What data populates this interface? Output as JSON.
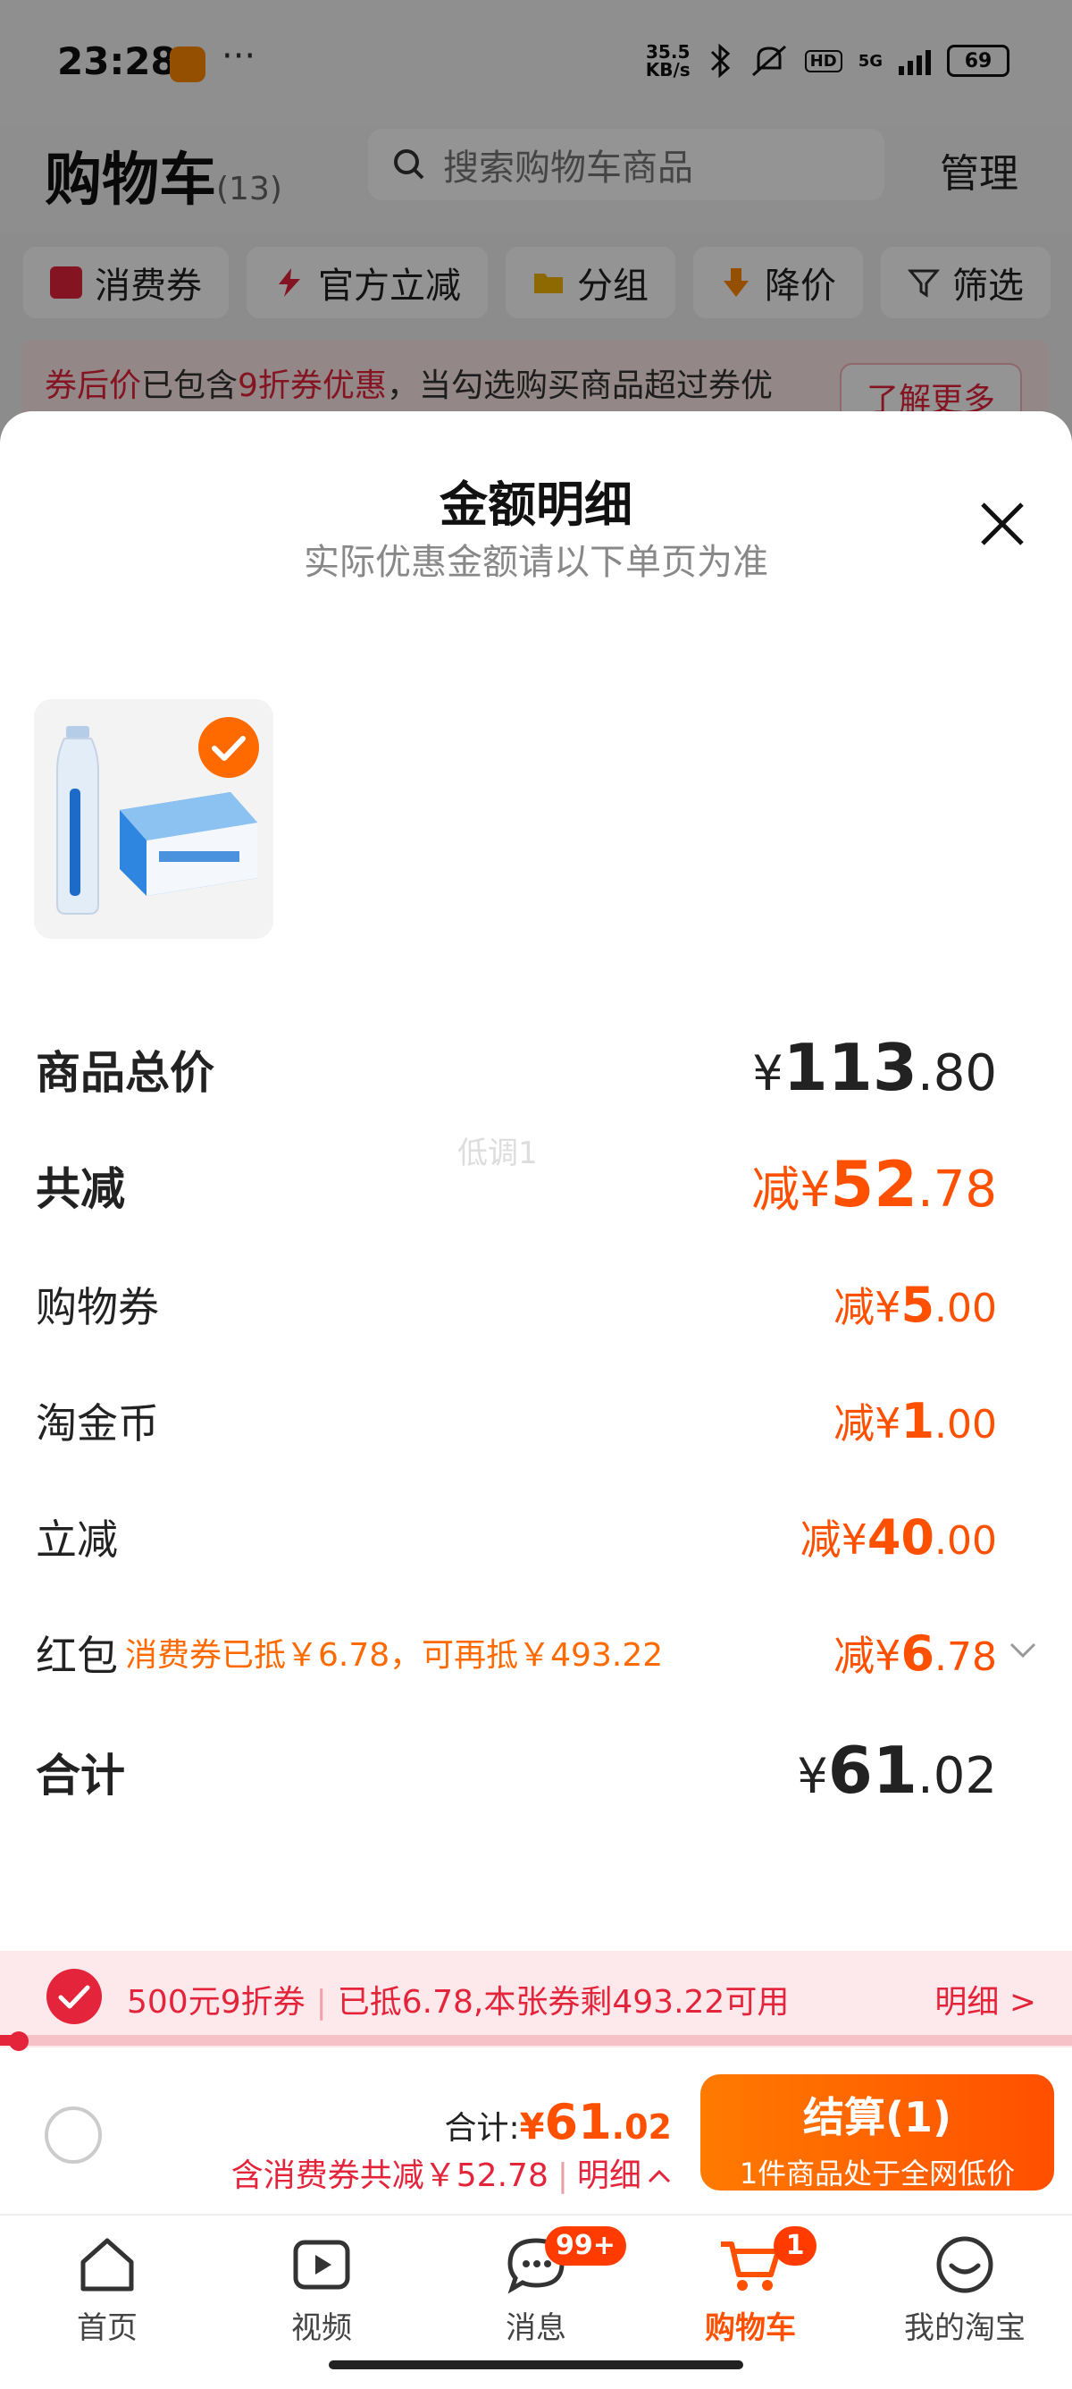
{
  "status_bar": {
    "time": "23:28",
    "speed_top": "35.5",
    "speed_bottom": "KB/s",
    "network": "5G",
    "hd": "HD",
    "battery": "69"
  },
  "header": {
    "title": "购物车",
    "count": "(13)",
    "search_placeholder": "搜索购物车商品",
    "manage": "管理"
  },
  "filters": [
    {
      "label": "消费券",
      "icon": "coupon-icon"
    },
    {
      "label": "官方立减",
      "icon": "lightning-icon"
    },
    {
      "label": "分组",
      "icon": "folder-icon"
    },
    {
      "label": "降价",
      "icon": "down-arrow-icon"
    },
    {
      "label": "筛选",
      "icon": "filter-icon"
    }
  ],
  "promo": {
    "prefix": "券后价",
    "text_a": "已包含",
    "discount": "9折券优惠",
    "text_b": "，当勾选购买商品超过券优",
    "button": "了解更多"
  },
  "sheet": {
    "title": "金额明细",
    "subtitle": "实际优惠金额请以下单页为准",
    "watermark": "低调1",
    "rows": {
      "total_price": {
        "label": "商品总价",
        "yen": "¥",
        "int": "113",
        "dec": ".80"
      },
      "total_discount": {
        "label": "共减",
        "prefix": "减¥",
        "int": "52",
        "dec": ".78"
      },
      "shopping_coupon": {
        "label": "购物券",
        "prefix": "减¥",
        "int": "5",
        "dec": ".00"
      },
      "taojin_coin": {
        "label": "淘金币",
        "prefix": "减¥",
        "int": "1",
        "dec": ".00"
      },
      "instant_discount": {
        "label": "立减",
        "prefix": "减¥",
        "int": "40",
        "dec": ".00"
      },
      "red_packet": {
        "label": "红包",
        "note": "消费券已抵￥6.78，可再抵￥493.22",
        "prefix": "减¥",
        "int": "6",
        "dec": ".78"
      },
      "sum": {
        "label": "合计",
        "yen": "¥",
        "int": "61",
        "dec": ".02"
      }
    }
  },
  "coupon_strip": {
    "name": "500元9折券",
    "used": "已抵6.78,本张券剩493.22可用",
    "detail": "明细 >",
    "progress": 0.014
  },
  "checkout": {
    "total_label": "合计:",
    "yen": "¥",
    "total_int": "61",
    "total_dec": ".02",
    "saving": "含消费券共减￥52.78",
    "detail": "明细",
    "pay_label": "结算(1)",
    "pay_sub": "1件商品处于全网低价"
  },
  "tabs": [
    {
      "label": "首页",
      "icon": "home-icon"
    },
    {
      "label": "视频",
      "icon": "video-icon"
    },
    {
      "label": "消息",
      "icon": "message-icon",
      "badge": "99+"
    },
    {
      "label": "购物车",
      "icon": "cart-icon",
      "badge": "1",
      "active": true
    },
    {
      "label": "我的淘宝",
      "icon": "smiley-icon"
    }
  ],
  "colors": {
    "accent": "#ff5000",
    "coupon_red": "#e4243a",
    "gradient_start": "#ff7a00",
    "gradient_end": "#ff4f00"
  }
}
